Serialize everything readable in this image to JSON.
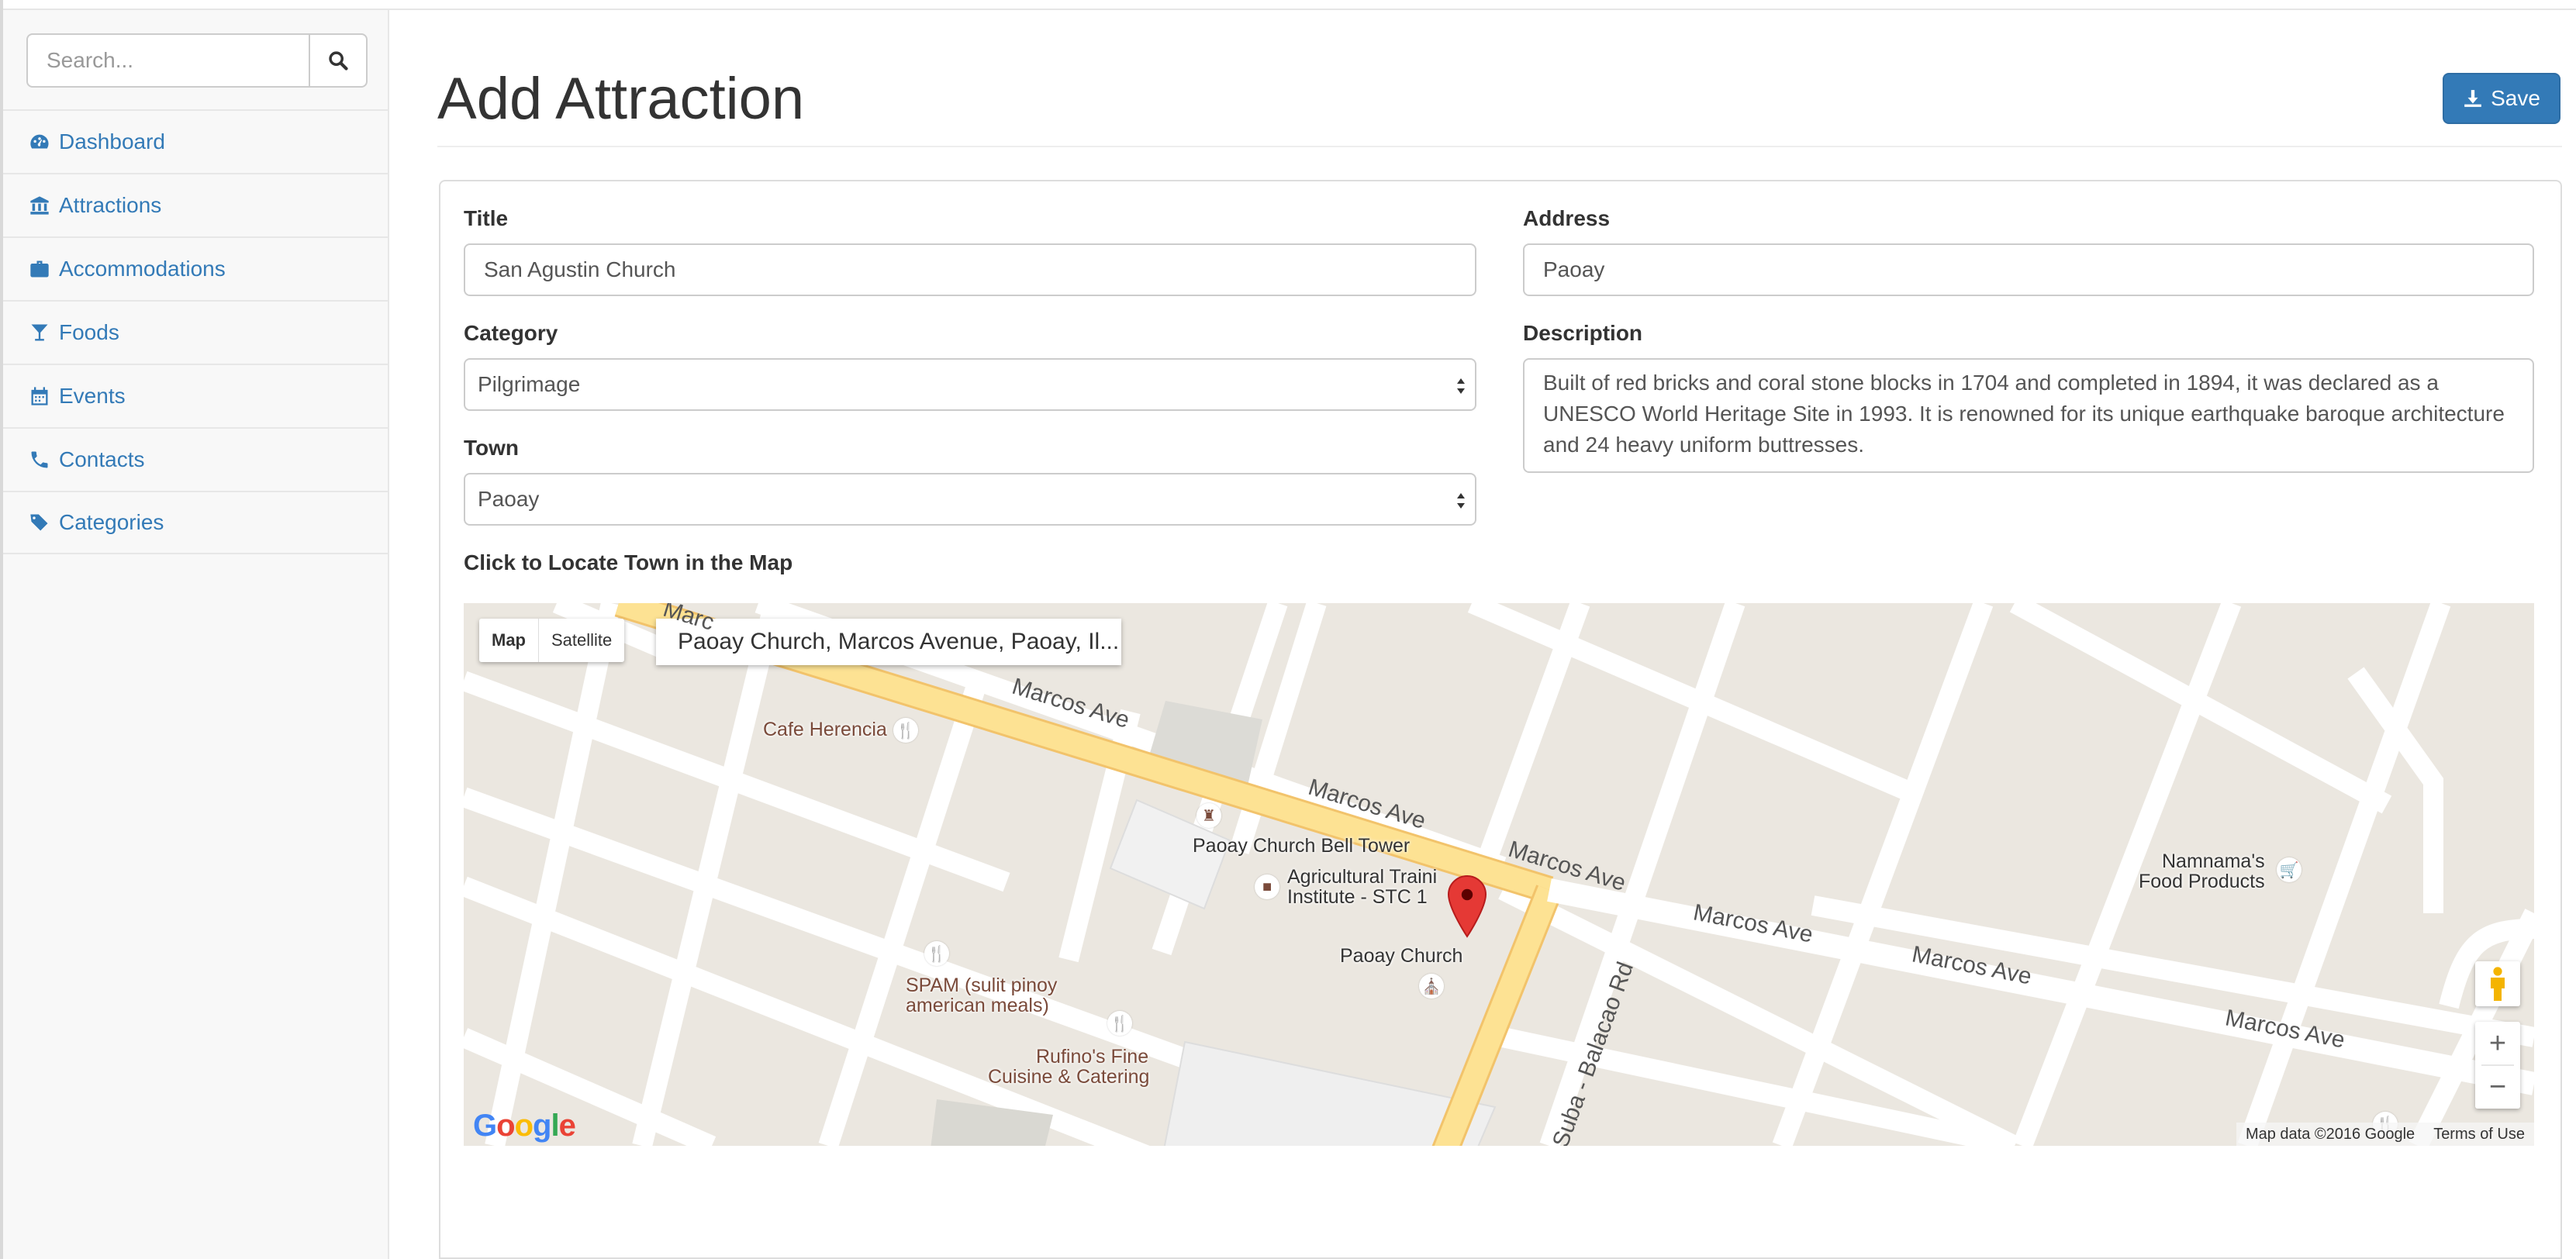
{
  "sidebar": {
    "search_placeholder": "Search...",
    "items": [
      {
        "label": "Dashboard",
        "icon": "dashboard-icon"
      },
      {
        "label": "Attractions",
        "icon": "institution-icon"
      },
      {
        "label": "Accommodations",
        "icon": "suitcase-icon"
      },
      {
        "label": "Foods",
        "icon": "glass-icon"
      },
      {
        "label": "Events",
        "icon": "calendar-icon"
      },
      {
        "label": "Contacts",
        "icon": "phone-icon"
      },
      {
        "label": "Categories",
        "icon": "tags-icon"
      }
    ]
  },
  "page": {
    "title": "Add Attraction",
    "save_label": "Save"
  },
  "form": {
    "title_label": "Title",
    "title_value": "San Agustin Church",
    "category_label": "Category",
    "category_value": "Pilgrimage",
    "town_label": "Town",
    "town_value": "Paoay",
    "address_label": "Address",
    "address_value": "Paoay",
    "description_label": "Description",
    "description_value": "Built of red bricks and coral stone blocks in 1704 and completed in 1894, it was declared as a UNESCO World Heritage Site in 1993. It is renowned for its unique earthquake baroque architecture and 24 heavy uniform buttresses.",
    "map_label": "Click to Locate Town in the Map"
  },
  "map": {
    "type_map": "Map",
    "type_satellite": "Satellite",
    "place_name": "Paoay Church, Marcos Avenue, Paoay, Il...",
    "places": {
      "cafe": "Cafe Herencia",
      "bell_tower": "Paoay Church Bell Tower",
      "agri_1": "Agricultural Traini",
      "agri_2": "Institute - STC 1",
      "church": "Paoay Church",
      "spam_1": "SPAM (sulit pinoy",
      "spam_2": "american meals)",
      "rufino_1": "Rufino's Fine",
      "rufino_2": "Cuisine & Catering",
      "namnama_1": "Namnama's",
      "namnama_2": "Food Products"
    },
    "roads": {
      "r1": "Marcos Ave",
      "r2": "Marcos Ave",
      "r3": "Marcos Ave",
      "r4": "Marcos Ave",
      "r5": "Marcos Ave",
      "r6": "Marcos Ave",
      "r7": "ay - Suba - Balacao Rd",
      "r8": "Marc"
    },
    "zoom_in": "+",
    "zoom_out": "−",
    "logo": "Google",
    "attribution": "Map data ©2016 Google",
    "terms": "Terms of Use"
  },
  "colors": {
    "link": "#337ab7",
    "primary": "#337ab7",
    "road_major": "#fde293",
    "map_bg": "#ebe7e0",
    "pin": "#e53935"
  }
}
